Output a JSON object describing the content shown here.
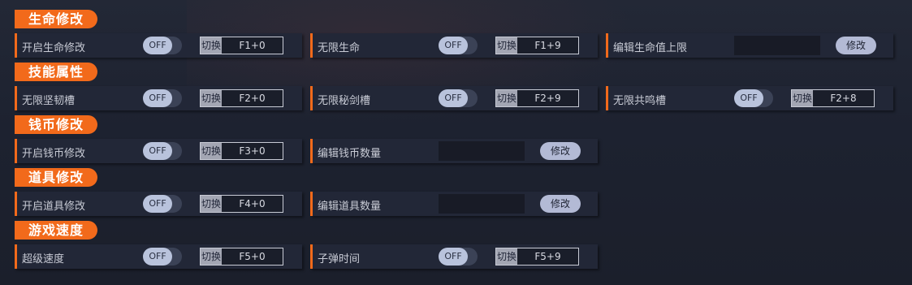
{
  "sections": [
    {
      "title": "生命修改",
      "rows": [
        {
          "label": "开启生命修改",
          "type": "toggle",
          "toggle": "OFF",
          "hk_label": "切换",
          "hotkey": "F1+0"
        },
        {
          "label": "无限生命",
          "type": "toggle",
          "toggle": "OFF",
          "hk_label": "切换",
          "hotkey": "F1+9"
        },
        {
          "label": "编辑生命值上限",
          "type": "edit",
          "input_value": "",
          "button": "修改"
        }
      ]
    },
    {
      "title": "技能属性",
      "rows": [
        {
          "label": "无限坚韧槽",
          "type": "toggle",
          "toggle": "OFF",
          "hk_label": "切换",
          "hotkey": "F2+0"
        },
        {
          "label": "无限秘剑槽",
          "type": "toggle",
          "toggle": "OFF",
          "hk_label": "切换",
          "hotkey": "F2+9"
        },
        {
          "label": "无限共鸣槽",
          "type": "toggle",
          "toggle": "OFF",
          "hk_label": "切换",
          "hotkey": "F2+8"
        }
      ]
    },
    {
      "title": "钱币修改",
      "rows": [
        {
          "label": "开启钱币修改",
          "type": "toggle",
          "toggle": "OFF",
          "hk_label": "切换",
          "hotkey": "F3+0"
        },
        {
          "label": "编辑钱币数量",
          "type": "edit",
          "input_value": "",
          "button": "修改"
        }
      ]
    },
    {
      "title": "道具修改",
      "rows": [
        {
          "label": "开启道具修改",
          "type": "toggle",
          "toggle": "OFF",
          "hk_label": "切换",
          "hotkey": "F4+0"
        },
        {
          "label": "编辑道具数量",
          "type": "edit",
          "input_value": "",
          "button": "修改"
        }
      ]
    },
    {
      "title": "游戏速度",
      "rows": [
        {
          "label": "超级速度",
          "type": "toggle",
          "toggle": "OFF",
          "hk_label": "切换",
          "hotkey": "F5+0"
        },
        {
          "label": "子弹时间",
          "type": "toggle",
          "toggle": "OFF",
          "hk_label": "切换",
          "hotkey": "F5+9"
        }
      ]
    }
  ],
  "colors": {
    "accent": "#f26a1b",
    "row_bg": "#222737",
    "toggle_knob": "#b9c3dc"
  }
}
